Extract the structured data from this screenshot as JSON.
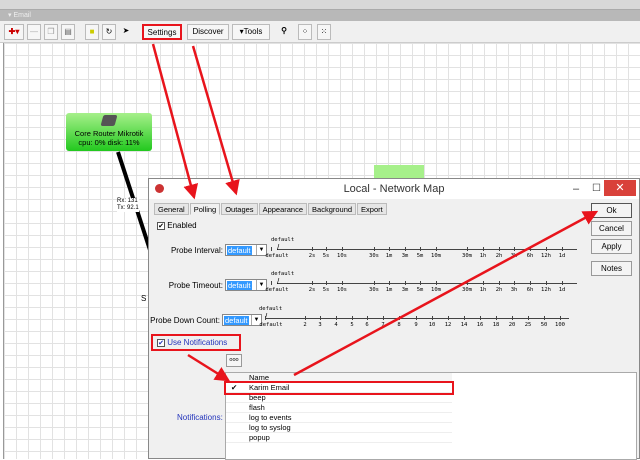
{
  "window": {
    "title": "Email"
  },
  "toolbar": {
    "settings": "Settings",
    "discover": "Discover",
    "tools": "▾Tools"
  },
  "map": {
    "node_name": "Core Router Mikrotik",
    "node_stats": "cpu: 0% disk: 11%",
    "link_rx": "Rx: 131",
    "link_tx": "Tx: 92.1",
    "stub": "S"
  },
  "dialog": {
    "title": "Local - Network Map",
    "tabs": [
      "General",
      "Polling",
      "Outages",
      "Appearance",
      "Background",
      "Export"
    ],
    "buttons": {
      "ok": "Ok",
      "cancel": "Cancel",
      "apply": "Apply",
      "notes": "Notes"
    },
    "enabled_label": "Enabled",
    "probe_interval_label": "Probe Interval:",
    "probe_timeout_label": "Probe Timeout:",
    "probe_down_label": "Probe Down Count:",
    "select_value": "default",
    "slider_default": "default",
    "time_ticks": [
      "default",
      "2s",
      "5s",
      "10s",
      "30s",
      "1m",
      "3m",
      "5m",
      "10m",
      "30m",
      "1h",
      "2h",
      "3h",
      "6h",
      "12h",
      "1d"
    ],
    "count_ticks": [
      "default",
      "2",
      "3",
      "4",
      "5",
      "6",
      "7",
      "8",
      "9",
      "10",
      "12",
      "14",
      "16",
      "18",
      "20",
      "25",
      "50",
      "100"
    ],
    "use_notifications_label": "Use Notifications",
    "notifications_label": "Notifications:",
    "ellipsis": "ooo",
    "list_header": "Name",
    "notifications": [
      {
        "name": "Karim Email",
        "checked": true
      },
      {
        "name": "beep",
        "checked": false
      },
      {
        "name": "flash",
        "checked": false
      },
      {
        "name": "log to events",
        "checked": false
      },
      {
        "name": "log to syslog",
        "checked": false
      },
      {
        "name": "popup",
        "checked": false
      }
    ]
  },
  "colors": {
    "annotation": "#e8141c",
    "node": "#22c81e",
    "selection": "#3399ff",
    "close": "#d9413a"
  }
}
